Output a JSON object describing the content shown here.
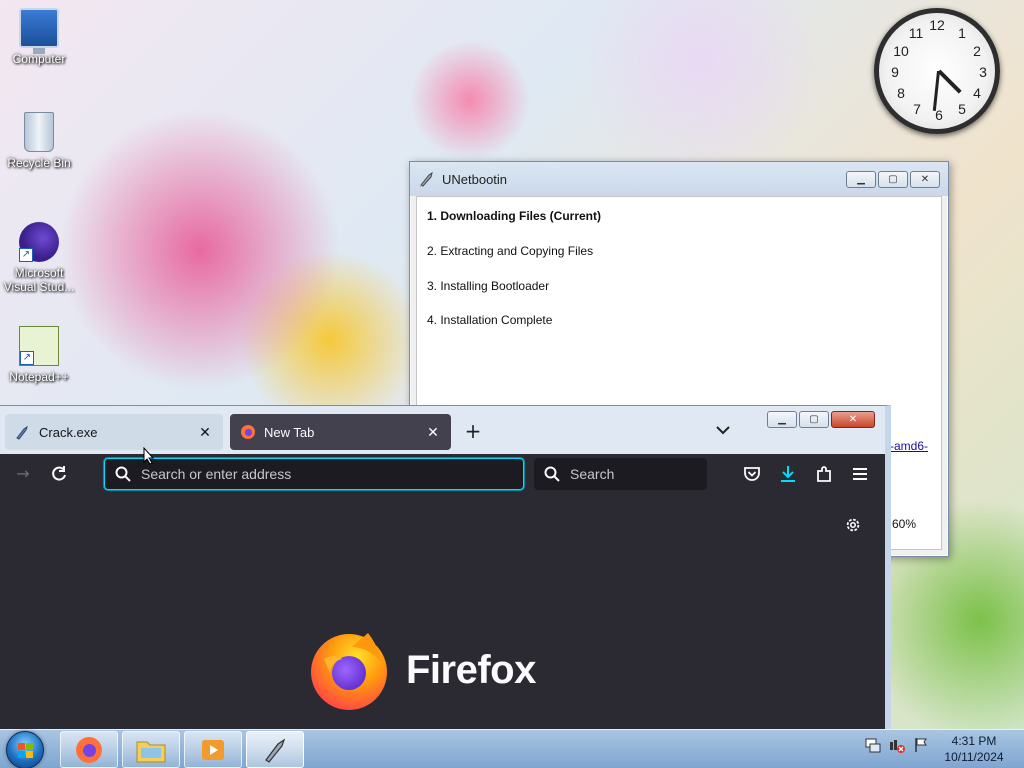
{
  "desktop": {
    "icons": [
      {
        "label": "Computer",
        "icon": "computer-icon"
      },
      {
        "label": "Recycle Bin",
        "icon": "recycle-bin-icon"
      },
      {
        "label": "Microsoft Visual Stud...",
        "icon": "visual-studio-icon"
      },
      {
        "label": "Notepad++",
        "icon": "notepad-plus-plus-icon"
      }
    ]
  },
  "clock": {
    "numbers": [
      "12",
      "1",
      "2",
      "3",
      "4",
      "5",
      "6",
      "7",
      "8",
      "9",
      "10",
      "11"
    ],
    "time": "4:31"
  },
  "unetbootin": {
    "title": "UNetbootin",
    "steps": [
      "1. Downloading Files (Current)",
      "2. Extracting and Copying Files",
      "3. Installing Bootloader",
      "4. Installation Complete"
    ],
    "partial_link": "-amd6-",
    "partial_progress": "60%"
  },
  "firefox": {
    "tabs": [
      {
        "label": "Crack.exe",
        "icon": "crack-exe-icon"
      },
      {
        "label": "New Tab",
        "icon": "firefox-icon"
      }
    ],
    "url_placeholder": "Search or enter address",
    "search_placeholder": "Search",
    "wordmark": "Firefox",
    "colors": {
      "accent": "#00ddff",
      "background": "#2b2a33",
      "toolbar": "#2b2a33"
    }
  },
  "taskbar": {
    "apps": [
      {
        "name": "firefox",
        "icon": "firefox-icon"
      },
      {
        "name": "file-explorer",
        "icon": "folder-icon"
      },
      {
        "name": "media-player",
        "icon": "media-player-icon"
      },
      {
        "name": "unetbootin",
        "icon": "unetbootin-icon"
      }
    ],
    "time": "4:31 PM",
    "date": "10/11/2024"
  }
}
